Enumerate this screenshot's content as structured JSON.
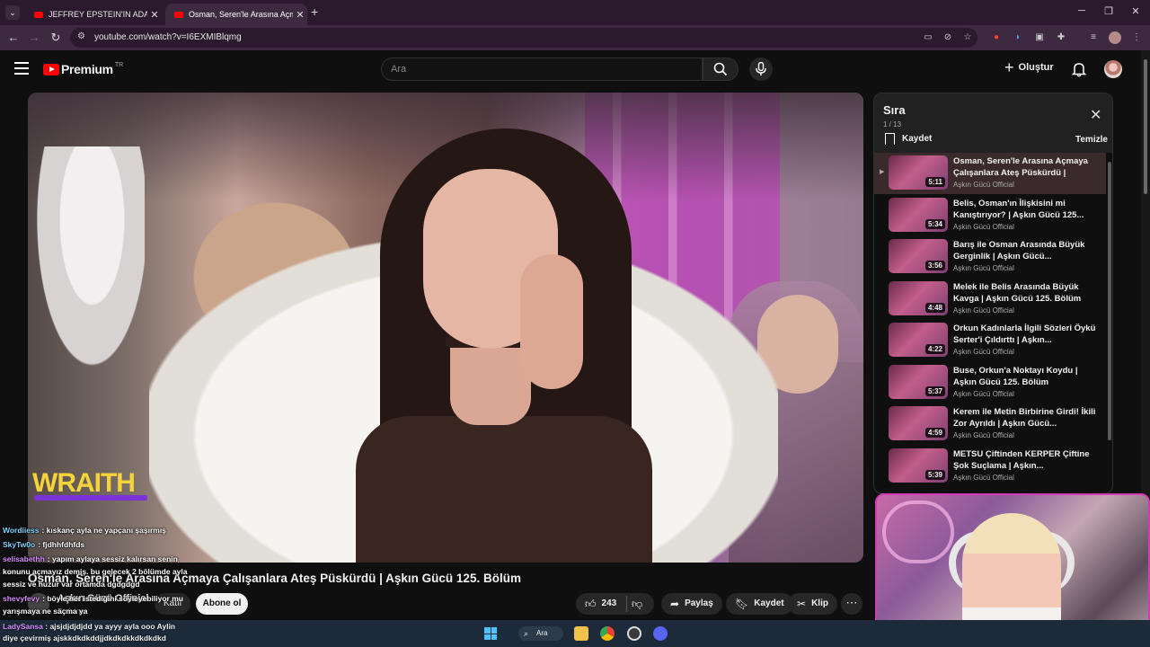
{
  "browser": {
    "tabs": [
      {
        "label": "JEFFREY EPSTEIN'IN ADASINA S"
      },
      {
        "label": "Osman, Seren'le Arasına Açmaya"
      }
    ],
    "url": "youtube.com/watch?v=I6EXMIBlqmg"
  },
  "header": {
    "logo": "Premium",
    "country": "TR",
    "search_placeholder": "Ara",
    "create_label": "Oluştur"
  },
  "video": {
    "overlay_brand": "WRAITH",
    "title": "Osman, Seren'le Arasına Açmaya Çalışanlara Ateş Püskürdü | Aşkın Gücü 125. Bölüm",
    "channel": "Aşkın Gücü Official",
    "subscribers": "B abone",
    "join_label": "Katıl",
    "subscribe_label": "Abone ol",
    "likes": "243",
    "share_label": "Paylaş",
    "save_label": "Kaydet",
    "clip_label": "Klip"
  },
  "playlist": {
    "title": "Sıra",
    "count": "1 / 13",
    "save_label": "Kaydet",
    "clear_label": "Temizle",
    "items": [
      {
        "title": "Osman, Seren'le Arasına Açmaya Çalışanlara Ateş Püskürdü | Aşkın...",
        "channel": "Aşkın Gücü Official",
        "duration": "5:11",
        "current": true
      },
      {
        "title": "Belis, Osman'ın İlişkisini mi Kanıştırıyor? | Aşkın Gücü 125...",
        "channel": "Aşkın Gücü Official",
        "duration": "5:34"
      },
      {
        "title": "Barış ile Osman Arasında Büyük Gerginlik | Aşkın Gücü...",
        "channel": "Aşkın Gücü Official",
        "duration": "3:56"
      },
      {
        "title": "Melek ile Belis Arasında Büyük Kavga | Aşkın Gücü 125. Bölüm",
        "channel": "Aşkın Gücü Official",
        "duration": "4:48"
      },
      {
        "title": "Orkun Kadınlarla İlgili Sözleri Öykü Serter'i Çıldırttı | Aşkın...",
        "channel": "Aşkın Gücü Official",
        "duration": "4:22"
      },
      {
        "title": "Buse, Orkun'a Noktayı Koydu | Aşkın Gücü 125. Bölüm",
        "channel": "Aşkın Gücü Official",
        "duration": "5:37"
      },
      {
        "title": "Kerem ile Metin Birbirine Girdi! İkili Zor Ayrıldı | Aşkın Gücü...",
        "channel": "Aşkın Gücü Official",
        "duration": "4:59"
      },
      {
        "title": "METSU Çiftinden KERPER Çiftine Şok Suçlama | Aşkın...",
        "channel": "Aşkın Gücü Official",
        "duration": "5:39"
      }
    ]
  },
  "chat": {
    "messages": [
      {
        "user": "Wordiiess",
        "text": ": kıskanç ayla ne yapçanı şaşırmış",
        "color": "#7fd3ff"
      },
      {
        "user": "SkyTw0o",
        "text": ": fjdhhfdhfds",
        "color": "#7fd3ff"
      },
      {
        "user": "selisabethh",
        "text": ": yapım aylaya sessiz kalırsan senin",
        "color": "#d98cff"
      },
      {
        "user": "",
        "text": "konunu açmayız demiş. bu gelecek 2 bölümde ayla",
        "color": "#ffffff"
      },
      {
        "user": "",
        "text": "sessiz ve huzur var ortamda dgdgdgd",
        "color": "#ffffff"
      },
      {
        "user": "shevyfevy",
        "text": ": böyle her istediğini söyleyebiliyor mu",
        "color": "#d98cff"
      },
      {
        "user": "",
        "text": "yarışmaya ne saçma ya",
        "color": "#ffffff"
      }
    ],
    "last_user": "LadySansa",
    "last_text": ": ajsjdjdjdjdd ya ayyy ayla ooo Aylin",
    "last_text2": "diye çevirmiş ajskkdkdkddjjdkdkdkkdkdkdkd"
  },
  "taskbar": {
    "search_label": "Ara"
  },
  "colors": {
    "youtube_red": "#ff0000",
    "overlay_yellow": "#f5d43b",
    "overlay_purple": "#7a33d6",
    "cam_border": "#d43ab3"
  }
}
